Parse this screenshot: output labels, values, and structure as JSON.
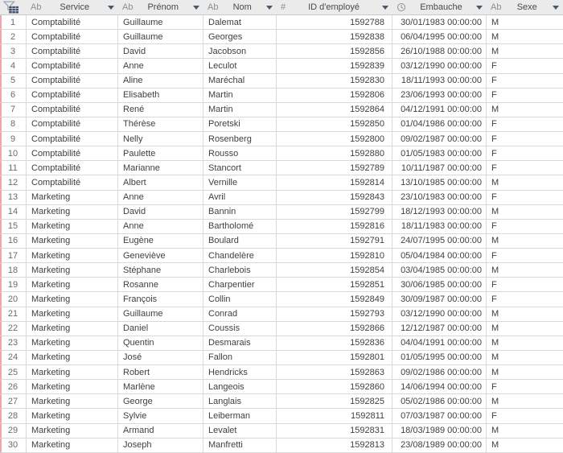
{
  "table": {
    "corner_icon": "table-filter-icon",
    "columns": [
      {
        "key": "service",
        "type_icon": "Ab",
        "label": "Service"
      },
      {
        "key": "prenom",
        "type_icon": "Ab",
        "label": "Prénom"
      },
      {
        "key": "nom",
        "type_icon": "Ab",
        "label": "Nom"
      },
      {
        "key": "id",
        "type_icon": "#",
        "label": "ID d'employé"
      },
      {
        "key": "embauche",
        "type_icon": "clock",
        "label": "Embauche"
      },
      {
        "key": "sexe",
        "type_icon": "Ab",
        "label": "Sexe"
      }
    ],
    "rows": [
      [
        "1",
        "Comptabilité",
        "Guillaume",
        "Dalemat",
        "1592788",
        "30/01/1983 00:00:00",
        "M"
      ],
      [
        "2",
        "Comptabilité",
        "Guillaume",
        "Georges",
        "1592838",
        "06/04/1995 00:00:00",
        "M"
      ],
      [
        "3",
        "Comptabilité",
        "David",
        "Jacobson",
        "1592856",
        "26/10/1988 00:00:00",
        "M"
      ],
      [
        "4",
        "Comptabilité",
        "Anne",
        "Leculot",
        "1592839",
        "03/12/1990 00:00:00",
        "F"
      ],
      [
        "5",
        "Comptabilité",
        "Aline",
        "Maréchal",
        "1592830",
        "18/11/1993 00:00:00",
        "F"
      ],
      [
        "6",
        "Comptabilité",
        "Elisabeth",
        "Martin",
        "1592806",
        "23/06/1993 00:00:00",
        "F"
      ],
      [
        "7",
        "Comptabilité",
        "René",
        "Martin",
        "1592864",
        "04/12/1991 00:00:00",
        "M"
      ],
      [
        "8",
        "Comptabilité",
        "Thérèse",
        "Poretski",
        "1592850",
        "01/04/1986 00:00:00",
        "F"
      ],
      [
        "9",
        "Comptabilité",
        "Nelly",
        "Rosenberg",
        "1592800",
        "09/02/1987 00:00:00",
        "F"
      ],
      [
        "10",
        "Comptabilité",
        "Paulette",
        "Rousso",
        "1592880",
        "01/05/1983 00:00:00",
        "F"
      ],
      [
        "11",
        "Comptabilité",
        "Marianne",
        "Stancort",
        "1592789",
        "10/11/1987 00:00:00",
        "F"
      ],
      [
        "12",
        "Comptabilité",
        "Albert",
        "Vernille",
        "1592814",
        "13/10/1985 00:00:00",
        "M"
      ],
      [
        "13",
        "Marketing",
        "Anne",
        "Avril",
        "1592843",
        "23/10/1983 00:00:00",
        "F"
      ],
      [
        "14",
        "Marketing",
        "David",
        "Bannin",
        "1592799",
        "18/12/1993 00:00:00",
        "M"
      ],
      [
        "15",
        "Marketing",
        "Anne",
        "Bartholomé",
        "1592816",
        "18/11/1983 00:00:00",
        "F"
      ],
      [
        "16",
        "Marketing",
        "Eugène",
        "Boulard",
        "1592791",
        "24/07/1995 00:00:00",
        "M"
      ],
      [
        "17",
        "Marketing",
        "Geneviève",
        "Chandelère",
        "1592810",
        "05/04/1984 00:00:00",
        "F"
      ],
      [
        "18",
        "Marketing",
        "Stéphane",
        "Charlebois",
        "1592854",
        "03/04/1985 00:00:00",
        "M"
      ],
      [
        "19",
        "Marketing",
        "Rosanne",
        "Charpentier",
        "1592851",
        "30/06/1985 00:00:00",
        "F"
      ],
      [
        "20",
        "Marketing",
        "François",
        "Collin",
        "1592849",
        "30/09/1987 00:00:00",
        "F"
      ],
      [
        "21",
        "Marketing",
        "Guillaume",
        "Conrad",
        "1592793",
        "03/12/1990 00:00:00",
        "M"
      ],
      [
        "22",
        "Marketing",
        "Daniel",
        "Coussis",
        "1592866",
        "12/12/1987 00:00:00",
        "M"
      ],
      [
        "23",
        "Marketing",
        "Quentin",
        "Desmarais",
        "1592836",
        "04/04/1991 00:00:00",
        "M"
      ],
      [
        "24",
        "Marketing",
        "José",
        "Fallon",
        "1592801",
        "01/05/1995 00:00:00",
        "M"
      ],
      [
        "25",
        "Marketing",
        "Robert",
        "Hendricks",
        "1592863",
        "09/02/1986 00:00:00",
        "M"
      ],
      [
        "26",
        "Marketing",
        "Marlène",
        "Langeois",
        "1592860",
        "14/06/1994 00:00:00",
        "F"
      ],
      [
        "27",
        "Marketing",
        "George",
        "Langlais",
        "1592825",
        "05/02/1986 00:00:00",
        "M"
      ],
      [
        "28",
        "Marketing",
        "Sylvie",
        "Leiberman",
        "1592811",
        "07/03/1987 00:00:00",
        "F"
      ],
      [
        "29",
        "Marketing",
        "Armand",
        "Levalet",
        "1592831",
        "18/03/1989 00:00:00",
        "M"
      ],
      [
        "30",
        "Marketing",
        "Joseph",
        "Manfretti",
        "1592813",
        "23/08/1989 00:00:00",
        "M"
      ]
    ]
  },
  "colors": {
    "header_bg": "#ebebeb",
    "grid_line": "#d9d9d9",
    "header_text": "#4a4a4a",
    "cell_text": "#3f3f3f",
    "row_number_text": "#6a6a6a",
    "type_icon": "#8a8f94",
    "filter_arrow": "#41586d",
    "corner_icon_grid": "#44546a",
    "corner_icon_funnel": "#98a4ae",
    "left_strip": "#f1a4ad"
  }
}
